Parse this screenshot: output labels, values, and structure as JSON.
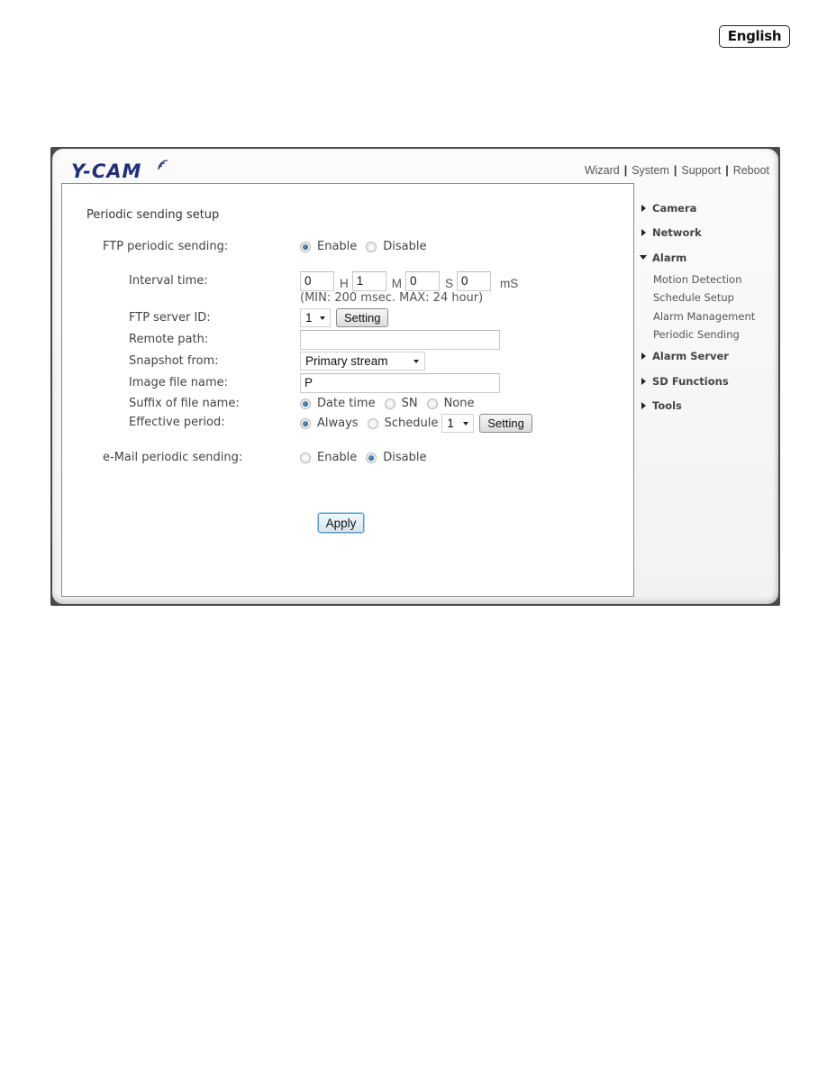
{
  "language_badge": "English",
  "app": {
    "logo_text": "Y-CAM",
    "top_nav": [
      {
        "label": "Wizard"
      },
      {
        "label": "System"
      },
      {
        "label": "Support"
      },
      {
        "label": "Reboot"
      }
    ],
    "nav_separator": "|"
  },
  "form": {
    "title": "Periodic sending setup",
    "ftp_periodic_sending": {
      "label": "FTP periodic sending:",
      "options": [
        "Enable",
        "Disable"
      ],
      "selected": "Enable"
    },
    "interval_time": {
      "label": "Interval time:",
      "hours": "0",
      "hours_unit": "H",
      "minutes": "1",
      "minutes_unit": "M",
      "seconds": "0",
      "seconds_unit": "S",
      "milliseconds": "0",
      "milliseconds_unit": "mS",
      "hint": "(MIN: 200 msec. MAX: 24 hour)"
    },
    "ftp_server_id": {
      "label": "FTP server ID:",
      "value": "1",
      "button_label": "Setting"
    },
    "remote_path": {
      "label": "Remote path:",
      "value": ""
    },
    "snapshot_from": {
      "label": "Snapshot from:",
      "value": "Primary stream"
    },
    "image_file_name": {
      "label": "Image file name:",
      "value": "P"
    },
    "suffix_of_file_name": {
      "label": "Suffix of file name:",
      "options": [
        "Date time",
        "SN",
        "None"
      ],
      "selected": "Date time"
    },
    "effective_period": {
      "label": "Effective period:",
      "options": [
        "Always",
        "Schedule"
      ],
      "selected": "Always",
      "schedule_value": "1",
      "button_label": "Setting"
    },
    "email_periodic_sending": {
      "label": "e-Mail periodic sending:",
      "options": [
        "Enable",
        "Disable"
      ],
      "selected": "Disable"
    },
    "apply_label": "Apply"
  },
  "sidebar": {
    "items": [
      {
        "label": "Camera",
        "expanded": false
      },
      {
        "label": "Network",
        "expanded": false
      },
      {
        "label": "Alarm",
        "expanded": true,
        "children": [
          "Motion Detection",
          "Schedule Setup",
          "Alarm Management",
          "Periodic Sending"
        ]
      },
      {
        "label": "Alarm Server",
        "expanded": false
      },
      {
        "label": "SD Functions",
        "expanded": false
      },
      {
        "label": "Tools",
        "expanded": false
      }
    ]
  }
}
